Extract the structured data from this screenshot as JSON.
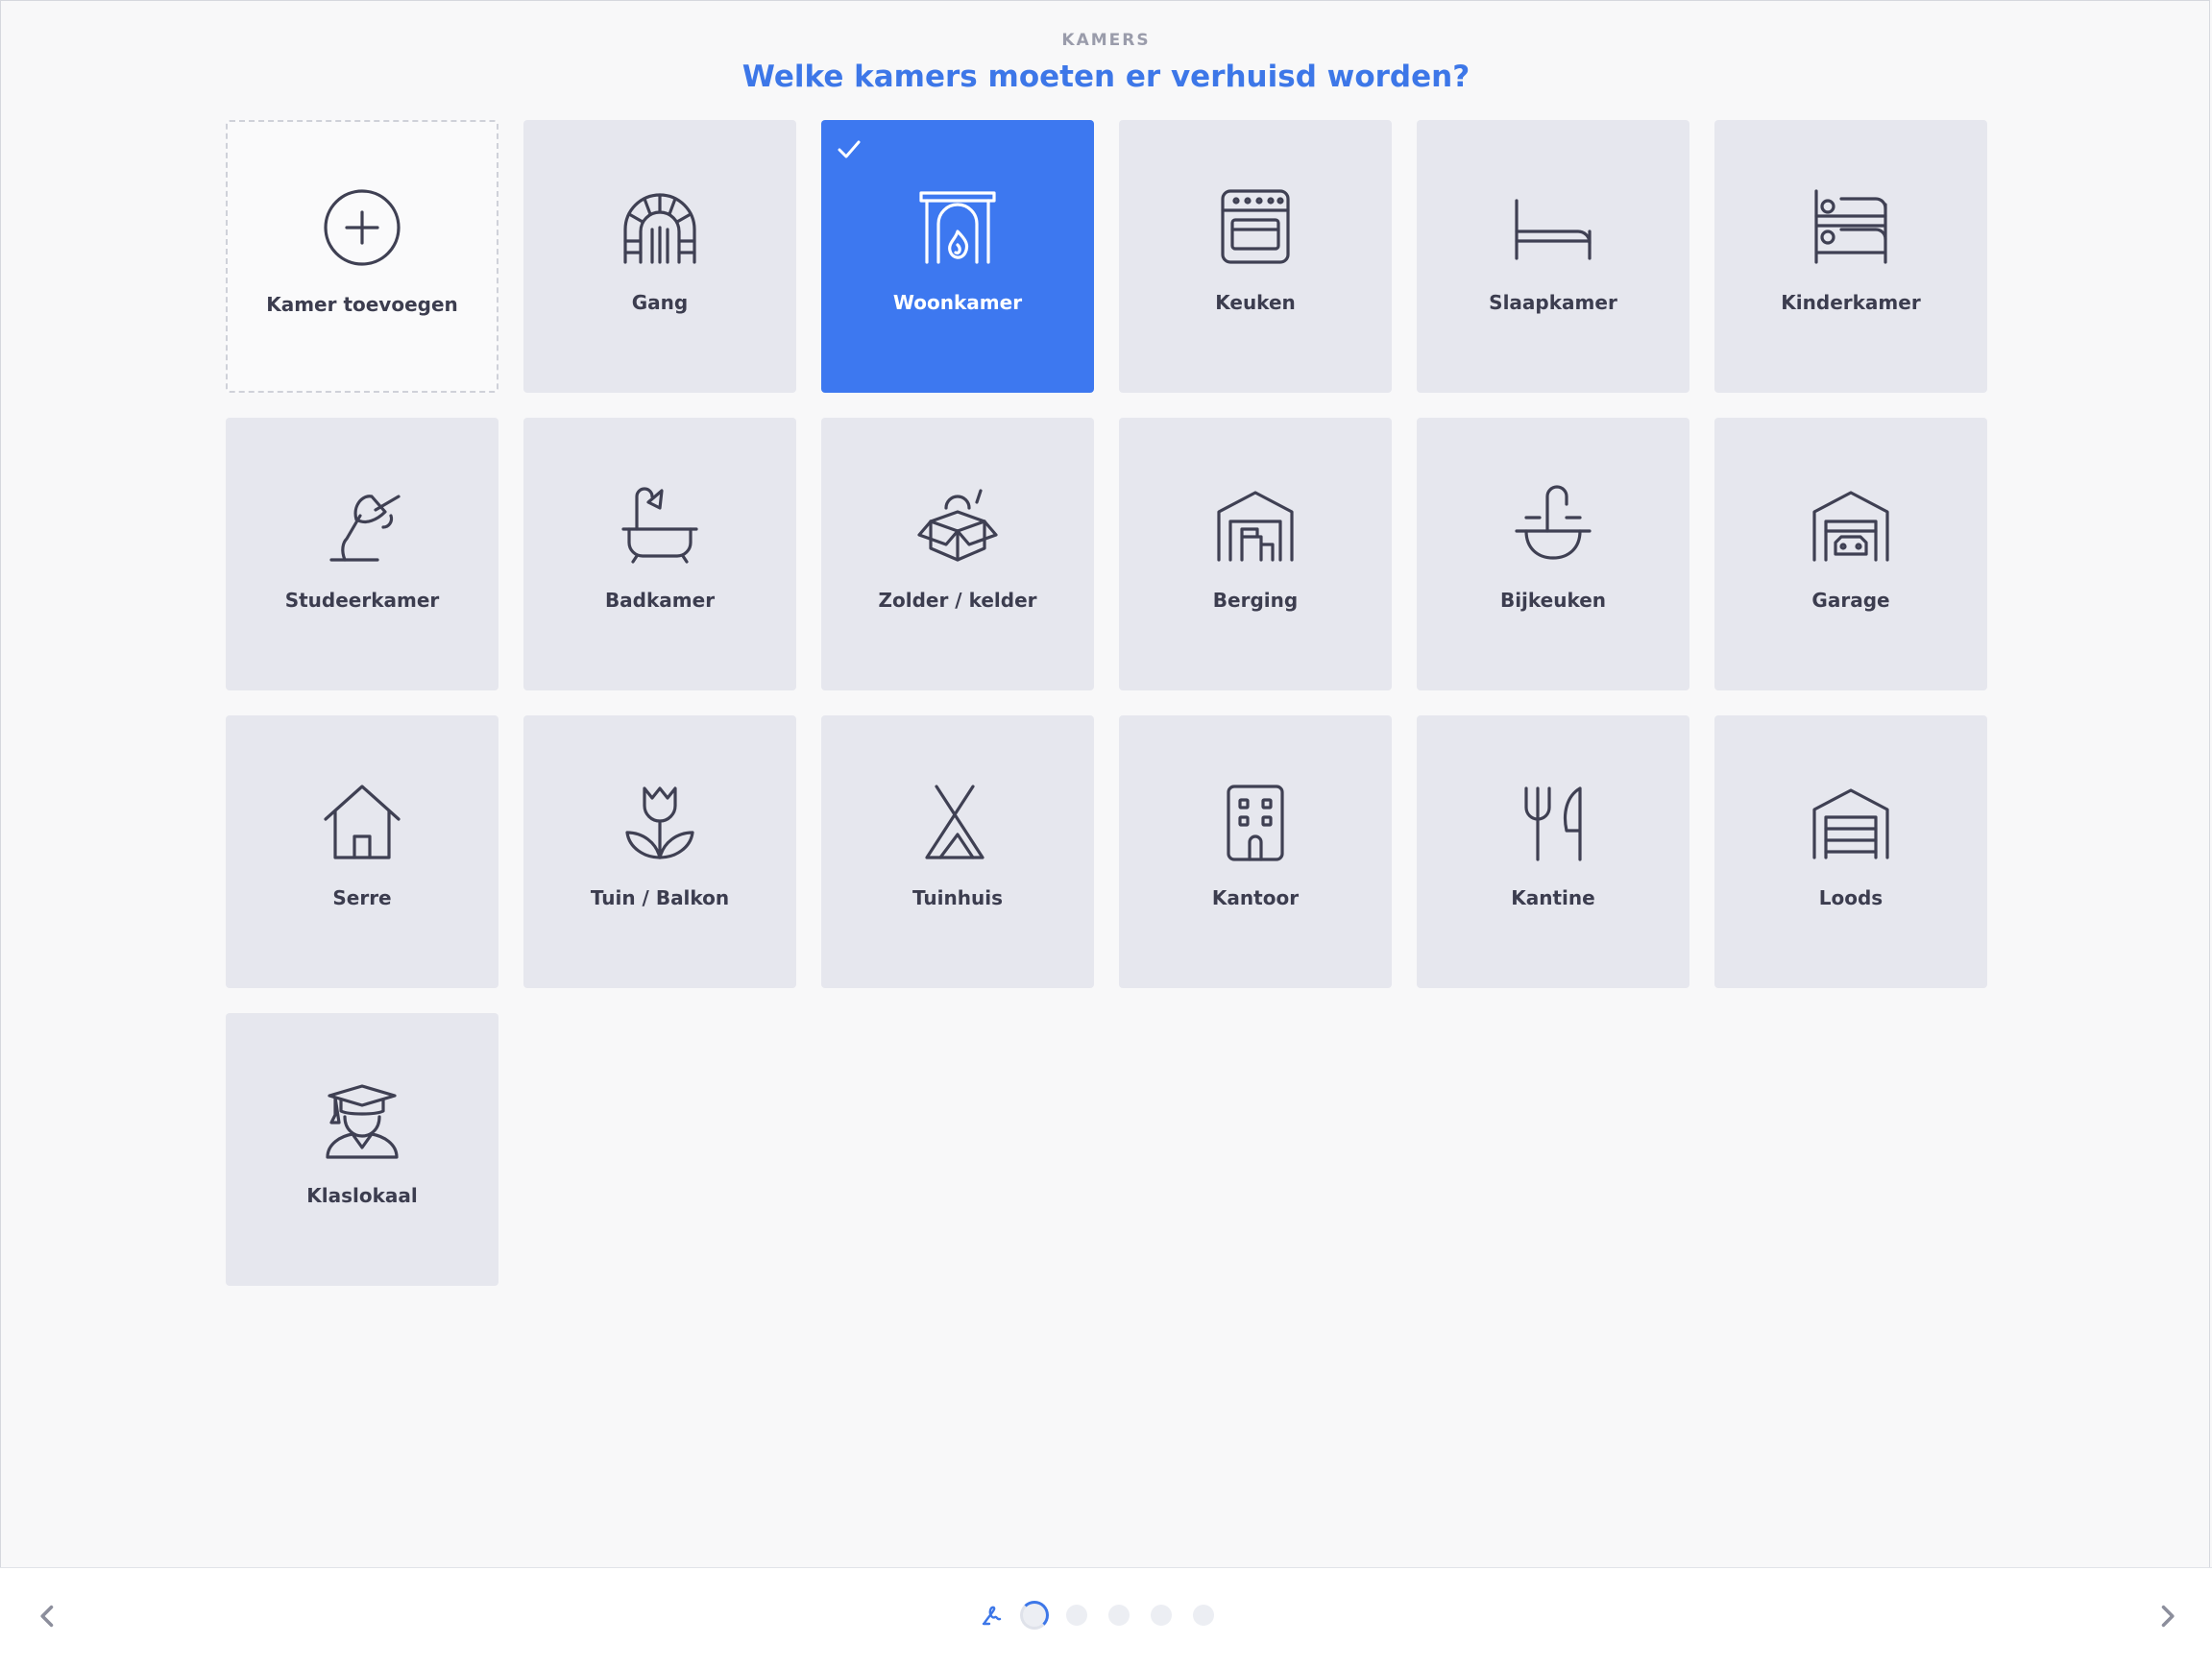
{
  "header": {
    "eyebrow": "KAMERS",
    "title": "Welke kamers moeten er verhuisd worden?"
  },
  "rooms": [
    {
      "label": "Kamer toevoegen",
      "icon": "plus-circle-icon",
      "kind": "add"
    },
    {
      "label": "Gang",
      "icon": "archway-icon"
    },
    {
      "label": "Woonkamer",
      "icon": "fireplace-icon",
      "selected": true
    },
    {
      "label": "Keuken",
      "icon": "oven-icon"
    },
    {
      "label": "Slaapkamer",
      "icon": "bed-icon"
    },
    {
      "label": "Kinderkamer",
      "icon": "bunk-bed-icon"
    },
    {
      "label": "Studeerkamer",
      "icon": "desk-lamp-icon"
    },
    {
      "label": "Badkamer",
      "icon": "bathtub-icon"
    },
    {
      "label": "Zolder / kelder",
      "icon": "open-box-icon"
    },
    {
      "label": "Berging",
      "icon": "storage-icon"
    },
    {
      "label": "Bijkeuken",
      "icon": "sink-icon"
    },
    {
      "label": "Garage",
      "icon": "garage-icon"
    },
    {
      "label": "Serre",
      "icon": "house-icon"
    },
    {
      "label": "Tuin / Balkon",
      "icon": "tulip-icon"
    },
    {
      "label": "Tuinhuis",
      "icon": "tent-icon"
    },
    {
      "label": "Kantoor",
      "icon": "office-building-icon"
    },
    {
      "label": "Kantine",
      "icon": "fork-knife-icon"
    },
    {
      "label": "Loods",
      "icon": "warehouse-icon"
    },
    {
      "label": "Klaslokaal",
      "icon": "graduate-icon"
    }
  ],
  "footer": {
    "steps_total": 6,
    "current_step": 2
  },
  "colors": {
    "accent": "#3d78f0",
    "card": "#e6e7ee",
    "icon": "#3f4053"
  }
}
